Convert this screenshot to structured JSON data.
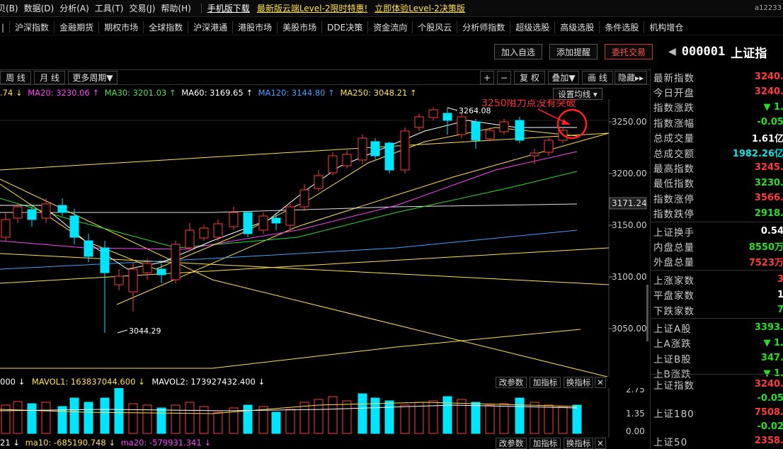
{
  "menubar": {
    "items": [
      "贝(B)",
      "数据(D)",
      "分析(A)",
      "工具(T)",
      "交易(J)",
      "帮助(H)"
    ],
    "links": [
      "手机版下载",
      "最新版云端Level-2限时特惠!",
      "立即体验Level-2决策版"
    ],
    "user": "a12233"
  },
  "navbar": [
    "沪深指数",
    "金融期货",
    "期权市场",
    "全球指数",
    "沪深港通",
    "港股市场",
    "美股市场",
    "DDE决策",
    "资金流向",
    "个股风云",
    "分析师指数",
    "超级选股",
    "高级选股",
    "条件选股",
    "机构增仓"
  ],
  "actions": {
    "add_watch": "加入自选",
    "add_alert": "添加提醒",
    "trade": "委托交易"
  },
  "stock": {
    "code": "000001",
    "name": "上证指"
  },
  "periods": {
    "week": "周 线",
    "month": "月 线",
    "more": "更多周期▼",
    "plus": "+",
    "minus": "−",
    "fq": "复 权",
    "overlay": "叠加▼",
    "line": "画 线",
    "hide": "隐藏▸▸"
  },
  "ma": {
    "ma5": ".74 ↓",
    "ma20": "MA20: 3230.06 ↑",
    "ma30": "MA30: 3201.03 ↑",
    "ma60": "MA60: 3169.65 ↑",
    "ma120": "MA120: 3144.80 ↑",
    "ma250": "MA250: 3048.21 ↑",
    "settings": "设置均线"
  },
  "annotation": "3250阻力点没有突破",
  "price_labels": {
    "high": "3264.08",
    "low": "3044.29",
    "current": "3171.24"
  },
  "y_ticks": [
    "3250.00",
    "3200.00",
    "3150.00",
    "3100.00",
    "3050.00"
  ],
  "vol": {
    "line1_a": "000 ↓",
    "line1_b": "MAVOL1: 163837044.600 ↓",
    "line1_c": "MAVOL2: 173927432.400 ↓",
    "line2_a": "21 ↓",
    "line2_b": "ma10: -685190.748 ↓",
    "line2_c": "ma20: -579931.341 ↓",
    "btn_params": "改参数",
    "btn_add": "加指标",
    "btn_switch": "换指标",
    "btn_close": "✕",
    "y_ticks": [
      "2.75",
      "1.35",
      "0.00"
    ]
  },
  "quote": {
    "rows": [
      {
        "k": "最新指数",
        "v": "3240.",
        "c": "red"
      },
      {
        "k": "今日开盘",
        "v": "3240.",
        "c": "red"
      },
      {
        "k": "指数涨跌",
        "v": "▼ 1.",
        "c": "grn"
      },
      {
        "k": "指数涨幅",
        "v": "-0.05",
        "c": "grn"
      },
      {
        "k": "总成交量",
        "v": "1.61亿",
        "c": "wht"
      },
      {
        "k": "总成交额",
        "v": "1982.26亿",
        "c": "cyan"
      },
      {
        "k": "最高指数",
        "v": "3245.",
        "c": "red"
      },
      {
        "k": "最低指数",
        "v": "3230.",
        "c": "grn"
      },
      {
        "k": "指数涨停",
        "v": "3566.",
        "c": "red"
      },
      {
        "k": "指数跌停",
        "v": "2918.",
        "c": "grn"
      },
      {
        "k": "上证换手",
        "v": "0.54",
        "c": "wht"
      },
      {
        "k": "内盘总量",
        "v": "8550万",
        "c": "grn"
      },
      {
        "k": "外盘总量",
        "v": "7523万",
        "c": "red"
      },
      {
        "k": "上涨家数",
        "v": "3",
        "c": "red"
      },
      {
        "k": "平盘家数",
        "v": "1",
        "c": "wht"
      },
      {
        "k": "下跌家数",
        "v": "7",
        "c": "grn"
      },
      {
        "k": "上证A股",
        "v": "3393.",
        "c": "grn"
      },
      {
        "k": "上A涨跌",
        "v": "▼ 1.",
        "c": "grn"
      },
      {
        "k": "上证B股",
        "v": "347.",
        "c": "grn"
      },
      {
        "k": "上B涨跌",
        "v": "▼ 1.",
        "c": "grn"
      }
    ],
    "bottom": [
      {
        "k": "上证指数",
        "v": "3240.",
        "v2": "-0.05"
      },
      {
        "k": "上证180",
        "v": "7508.",
        "v2": "-0.02"
      },
      {
        "k": "上证50",
        "v": "2358.",
        "v2": ""
      }
    ]
  },
  "colors": {
    "up": "#ff3b3b",
    "down": "#00e5ff",
    "ma5": "#ffffff",
    "ma10": "#ffe14a",
    "ma20": "#ff40ff",
    "ma30": "#25e025",
    "ma60": "#e0e0e0",
    "ma120": "#40a0ff",
    "ma250": "#ffe14a"
  }
}
